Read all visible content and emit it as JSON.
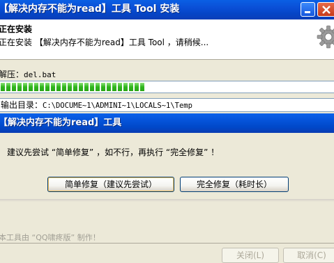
{
  "window": {
    "title": "【解决内存不能为read】工具 Tool 安装"
  },
  "header": {
    "heading": "正在安装",
    "subtitle": "正在安装 【解决内存不能为read】工具 Tool ，请稍候..."
  },
  "extract": {
    "label": "解压：",
    "filename": "del.bat"
  },
  "progress": {
    "fraction": 0.43,
    "color": "#2fb51c"
  },
  "output": {
    "label": "输出目录：",
    "path": "C:\\DOCUME~1\\ADMINI~1\\LOCALS~1\\Temp"
  },
  "dialog": {
    "title": "【解决内存不能为read】工具",
    "message": "建议先尝试 “简单修复” ，如不行，再执行 “完全修复” ！",
    "simple_button": "简单修复（建议先尝试）",
    "full_button": "完全修复（耗时长）"
  },
  "footer": {
    "credit": "本工具由 “QQ啸疼版” 制作！",
    "close_button": "关闭(L)",
    "cancel_button": "取消(C)"
  },
  "icons": {
    "gear": "gear-icon",
    "minimize": "minimize-icon",
    "close": "close-icon"
  }
}
